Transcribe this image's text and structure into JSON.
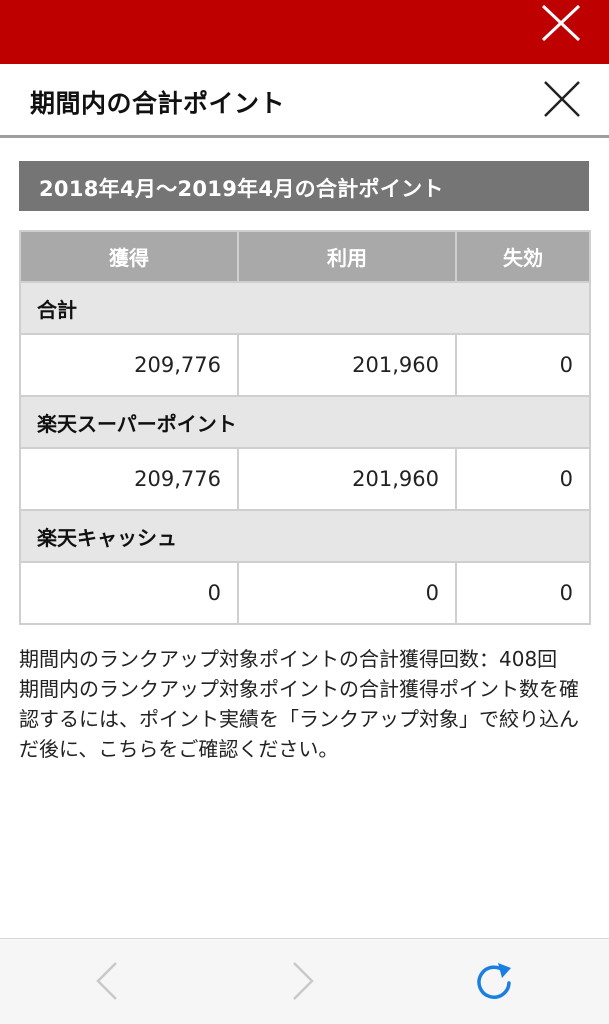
{
  "header": {
    "title": "期間内の合計ポイント"
  },
  "period": {
    "label": "2018年4月〜2019年4月の合計ポイント"
  },
  "table": {
    "columns": [
      "獲得",
      "利用",
      "失効"
    ],
    "sections": [
      {
        "label": "合計",
        "values": [
          "209,776",
          "201,960",
          "0"
        ]
      },
      {
        "label": "楽天スーパーポイント",
        "values": [
          "209,776",
          "201,960",
          "0"
        ]
      },
      {
        "label": "楽天キャッシュ",
        "values": [
          "0",
          "0",
          "0"
        ]
      }
    ]
  },
  "notes": {
    "line1": "期間内のランクアップ対象ポイントの合計獲得回数：408回",
    "line2": "期間内のランクアップ対象ポイントの合計獲得ポイント数を確認するには、ポイント実績を「ランクアップ対象」で絞り込んだ後に、こちらをご確認ください。"
  },
  "colors": {
    "brand_red": "#bf0000",
    "banner_gray": "#757575",
    "header_cell_gray": "#a9a9a9",
    "section_row_gray": "#e6e6e6",
    "reload_blue": "#1a7fe0"
  },
  "icons": {
    "top_close": "close-icon",
    "modal_close": "close-icon",
    "back": "chevron-left-icon",
    "forward": "chevron-right-icon",
    "reload": "reload-icon"
  }
}
